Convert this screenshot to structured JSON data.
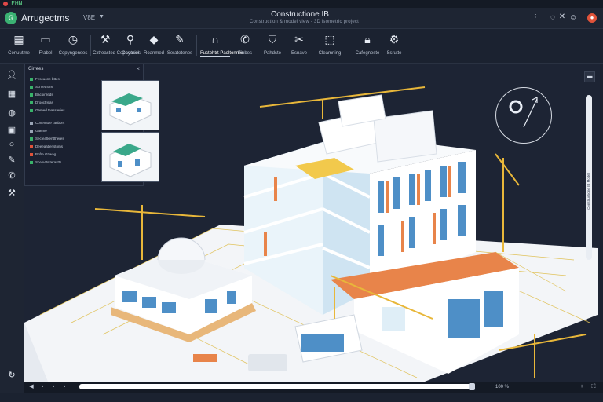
{
  "titlebar": {
    "text": "FHN"
  },
  "app": {
    "logo": "G",
    "name": "Arrugectms",
    "version": "V8E"
  },
  "document": {
    "title": "Constructione IB",
    "subtitle": "Construction & model view - 3D isometric project"
  },
  "window_icons": [
    "more-icon",
    "chat-icon",
    "close-icon",
    "help-icon",
    "record-icon"
  ],
  "ribbon": {
    "items": [
      {
        "label": "Conuutme",
        "icon": "grid-icon"
      },
      {
        "label": "Frabel",
        "icon": "document-icon"
      },
      {
        "label": "Copyngenses",
        "icon": "clock-icon"
      },
      {
        "label": "Cxtreasted\nCopaetnies",
        "icon": "tools-icon"
      },
      {
        "label": "Coyosel",
        "icon": "pin-icon"
      },
      {
        "label": "Roanmed",
        "icon": "diamond-icon"
      },
      {
        "label": "Seratetenes",
        "icon": "edit-icon"
      },
      {
        "label": "Fuctbhtrt\nPaoltonnes",
        "icon": "magnet-icon"
      },
      {
        "label": "Fiobes",
        "icon": "phone-icon"
      },
      {
        "label": "Pahdste",
        "icon": "tag-icon"
      },
      {
        "label": "Esnave",
        "icon": "scissors-icon"
      },
      {
        "label": "Cleamning",
        "icon": "box-icon"
      },
      {
        "label": "Cafegneste",
        "icon": "lock-icon"
      },
      {
        "label": "Ssrutte",
        "icon": "settings-icon"
      }
    ]
  },
  "layers": {
    "title": "Cirrees",
    "close": "×",
    "rows": [
      {
        "label": "Fescuone bttes",
        "color": "#39b26a"
      },
      {
        "label": "Scrnetntme",
        "color": "#39b26a"
      },
      {
        "label": "Bacoinreds",
        "color": "#39b26a"
      },
      {
        "label": "Drooct leas",
        "color": "#39b26a"
      },
      {
        "label": "Gamed teassieries",
        "color": "#39b26a"
      },
      {
        "label": "Conemtde ranbors",
        "color": "#9aa5b6"
      },
      {
        "label": "Gaeme",
        "color": "#9aa5b6"
      },
      {
        "label": "Secteatkertttheres",
        "color": "#39b26a"
      },
      {
        "label": "Deeeaatienstoms",
        "color": "#e0533a"
      },
      {
        "label": "Bofre Gttwag",
        "color": "#e0533a"
      },
      {
        "label": "Sceovtts terastts",
        "color": "#39b26a"
      }
    ]
  },
  "rightbar": {
    "label": "Constructione IB Model"
  },
  "statusbar": {
    "zoom": "100 %"
  },
  "colors": {
    "accent": "#3bb273",
    "record": "#e0533a",
    "crane": "#e8b73a",
    "window": "#4e8fc7",
    "cladding": "#e8844a"
  }
}
